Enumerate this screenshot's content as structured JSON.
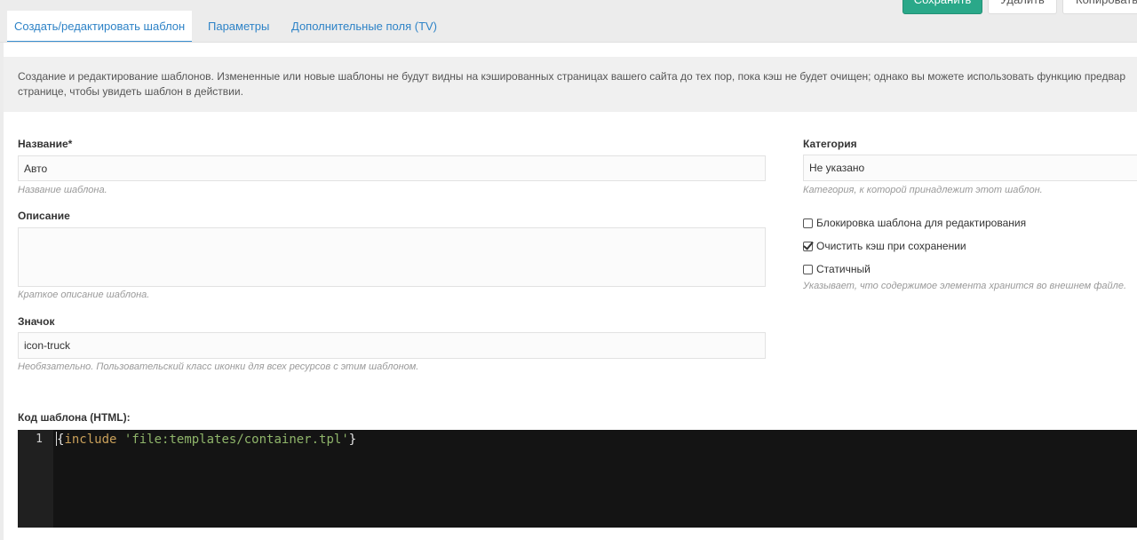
{
  "toolbar": {
    "save_label": "Сохранить",
    "delete_label": "Удалить",
    "copy_label": "Копировать"
  },
  "tabs": [
    {
      "label": "Создать/редактировать шаблон",
      "active": true
    },
    {
      "label": "Параметры",
      "active": false
    },
    {
      "label": "Дополнительные поля (TV)",
      "active": false
    }
  ],
  "description": {
    "line1": "Создание и редактирование шаблонов. Измененные или новые шаблоны не будут видны на кэшированных страницах вашего сайта до тех пор, пока кэш не будет очищен; однако вы можете использовать функцию предвар",
    "line2": "странице, чтобы увидеть шаблон в действии."
  },
  "form": {
    "name": {
      "label": "Название*",
      "value": "Авто",
      "hint": "Название шаблона."
    },
    "description": {
      "label": "Описание",
      "value": "",
      "hint": "Краткое описание шаблона."
    },
    "icon": {
      "label": "Значок",
      "value": "icon-truck",
      "hint": "Необязательно. Пользовательский класс иконки для всех ресурсов с этим шаблоном."
    },
    "category": {
      "label": "Категория",
      "value": "Не указано",
      "hint": "Категория, к которой принадлежит этот шаблон."
    },
    "checkboxes": [
      {
        "label": "Блокировка шаблона для редактирования",
        "checked": false
      },
      {
        "label": "Очистить кэш при сохранении",
        "checked": true
      },
      {
        "label": "Статичный",
        "checked": false
      }
    ],
    "static_hint": "Указывает, что содержимое элемента хранится во внешнем файле.",
    "code": {
      "label": "Код шаблона (HTML):",
      "line_number": "1",
      "open": "{",
      "keyword": "include",
      "space": " ",
      "string": "'file:templates/container.tpl'",
      "close": "}"
    }
  },
  "colors": {
    "primary": "#2aa889",
    "link": "#2e83c7",
    "editor_bg": "#141414"
  }
}
